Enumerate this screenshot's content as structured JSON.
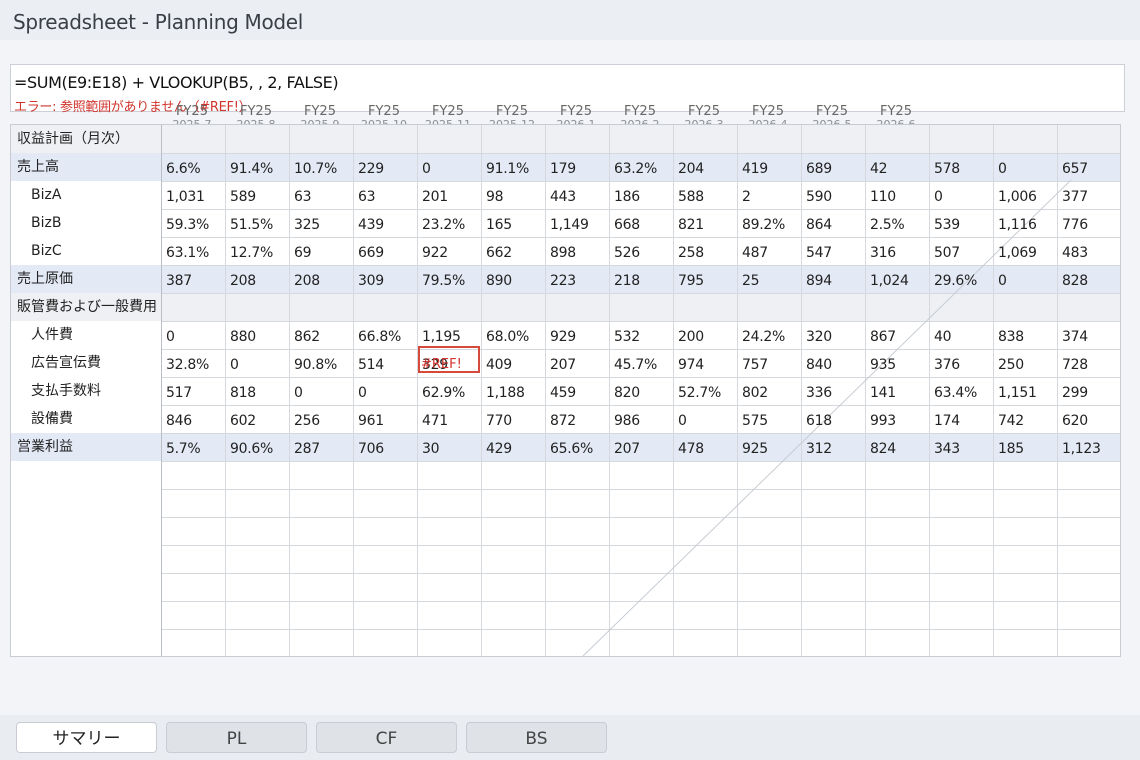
{
  "window": {
    "title": "Spreadsheet - Planning Model"
  },
  "formula_bar": {
    "formula": "=SUM(E9:E18) + VLOOKUP(B5, , 2, FALSE)",
    "error": "エラー: 参照範囲がありません（#REF!）"
  },
  "columns": [
    {
      "label": "FY25",
      "period": "2025-7"
    },
    {
      "label": "FY25",
      "period": "2025-8"
    },
    {
      "label": "FY25",
      "period": "2025-9"
    },
    {
      "label": "FY25",
      "period": "2025-10"
    },
    {
      "label": "FY25",
      "period": "2025-11"
    },
    {
      "label": "FY25",
      "period": "2025-12"
    },
    {
      "label": "FY25",
      "period": "2026-1"
    },
    {
      "label": "FY25",
      "period": "2026-2"
    },
    {
      "label": "FY25",
      "period": "2026-3"
    },
    {
      "label": "FY25",
      "period": "2026-4"
    },
    {
      "label": "FY25",
      "period": "2026-5"
    },
    {
      "label": "FY25",
      "period": "2026-6"
    }
  ],
  "rows": [
    {
      "label": "収益計画（月次）",
      "style": "section",
      "indent": false,
      "cells": []
    },
    {
      "label": "売上高",
      "style": "total",
      "indent": false,
      "cells": [
        "6.6%",
        "91.4%",
        "10.7%",
        "229",
        "0",
        "91.1%",
        "179",
        "63.2%",
        "204",
        "419",
        "689",
        "42",
        "578",
        "0",
        "657"
      ]
    },
    {
      "label": "BizA",
      "style": "normal",
      "indent": true,
      "cells": [
        "1,031",
        "589",
        "63",
        "63",
        "201",
        "98",
        "443",
        "186",
        "588",
        "2",
        "590",
        "110",
        "0",
        "1,006",
        "377"
      ]
    },
    {
      "label": "BizB",
      "style": "normal",
      "indent": true,
      "cells": [
        "59.3%",
        "51.5%",
        "325",
        "439",
        "23.2%",
        "165",
        "1,149",
        "668",
        "821",
        "89.2%",
        "864",
        "2.5%",
        "539",
        "1,116",
        "776"
      ]
    },
    {
      "label": "BizC",
      "style": "normal",
      "indent": true,
      "cells": [
        "63.1%",
        "12.7%",
        "69",
        "669",
        "922",
        "662",
        "898",
        "526",
        "258",
        "487",
        "547",
        "316",
        "507",
        "1,069",
        "483"
      ]
    },
    {
      "label": "売上原価",
      "style": "total",
      "indent": false,
      "cells": [
        "387",
        "208",
        "208",
        "309",
        "79.5%",
        "890",
        "223",
        "218",
        "795",
        "25",
        "894",
        "1,024",
        "29.6%",
        "0",
        "828"
      ]
    },
    {
      "label": "販管費および一般費用",
      "style": "section",
      "indent": false,
      "cells": []
    },
    {
      "label": "人件費",
      "style": "normal",
      "indent": true,
      "cells": [
        "0",
        "880",
        "862",
        "66.8%",
        "1,195",
        "68.0%",
        "929",
        "532",
        "200",
        "24.2%",
        "320",
        "867",
        "40",
        "838",
        "374"
      ]
    },
    {
      "label": "広告宣伝費",
      "style": "normal",
      "indent": true,
      "cells": [
        "32.8%",
        "0",
        "90.8%",
        "514",
        "329",
        "409",
        "207",
        "45.7%",
        "974",
        "757",
        "840",
        "935",
        "376",
        "250",
        "728"
      ]
    },
    {
      "label": "支払手数料",
      "style": "normal",
      "indent": true,
      "cells": [
        "517",
        "818",
        "0",
        "0",
        "62.9%",
        "1,188",
        "459",
        "820",
        "52.7%",
        "802",
        "336",
        "141",
        "63.4%",
        "1,151",
        "299"
      ]
    },
    {
      "label": "設備費",
      "style": "normal",
      "indent": true,
      "cells": [
        "846",
        "602",
        "256",
        "961",
        "471",
        "770",
        "872",
        "986",
        "0",
        "575",
        "618",
        "993",
        "174",
        "742",
        "620"
      ]
    },
    {
      "label": "営業利益",
      "style": "total",
      "indent": false,
      "cells": [
        "5.7%",
        "90.6%",
        "287",
        "706",
        "30",
        "429",
        "65.6%",
        "207",
        "478",
        "925",
        "312",
        "824",
        "343",
        "185",
        "1,123"
      ]
    }
  ],
  "ref_error_cell": {
    "row": 8,
    "col": 4,
    "text": "#REF!"
  },
  "sheet_tabs": [
    {
      "label": "サマリー",
      "active": true
    },
    {
      "label": "PL",
      "active": false
    },
    {
      "label": "CF",
      "active": false
    },
    {
      "label": "BS",
      "active": false
    }
  ],
  "colors": {
    "total_band": "#e3eaf5",
    "section_band": "#eef0f3",
    "error": "#d64a3c",
    "grid_line": "#d5d9de"
  }
}
